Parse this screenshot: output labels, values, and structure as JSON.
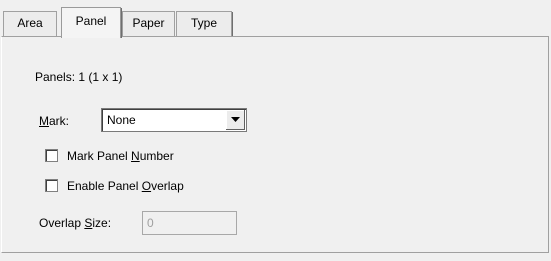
{
  "tabs": [
    {
      "label": "Area",
      "active": false
    },
    {
      "label": "Panel",
      "active": true
    },
    {
      "label": "Paper",
      "active": false
    },
    {
      "label": "Type",
      "active": false
    }
  ],
  "panel": {
    "panels_info": "Panels: 1  (1 x 1)",
    "mark": {
      "label_pre": "",
      "label_mnemonic": "M",
      "label_post": "ark:",
      "selected": "None"
    },
    "mark_panel_number": {
      "label_pre": "Mark Panel ",
      "label_mnemonic": "N",
      "label_post": "umber",
      "checked": false
    },
    "enable_panel_overlap": {
      "label_pre": "Enable Panel ",
      "label_mnemonic": "O",
      "label_post": "verlap",
      "checked": false
    },
    "overlap_size": {
      "label_pre": "Overlap ",
      "label_mnemonic": "S",
      "label_post": "ize:",
      "value": "0",
      "enabled": false
    }
  }
}
